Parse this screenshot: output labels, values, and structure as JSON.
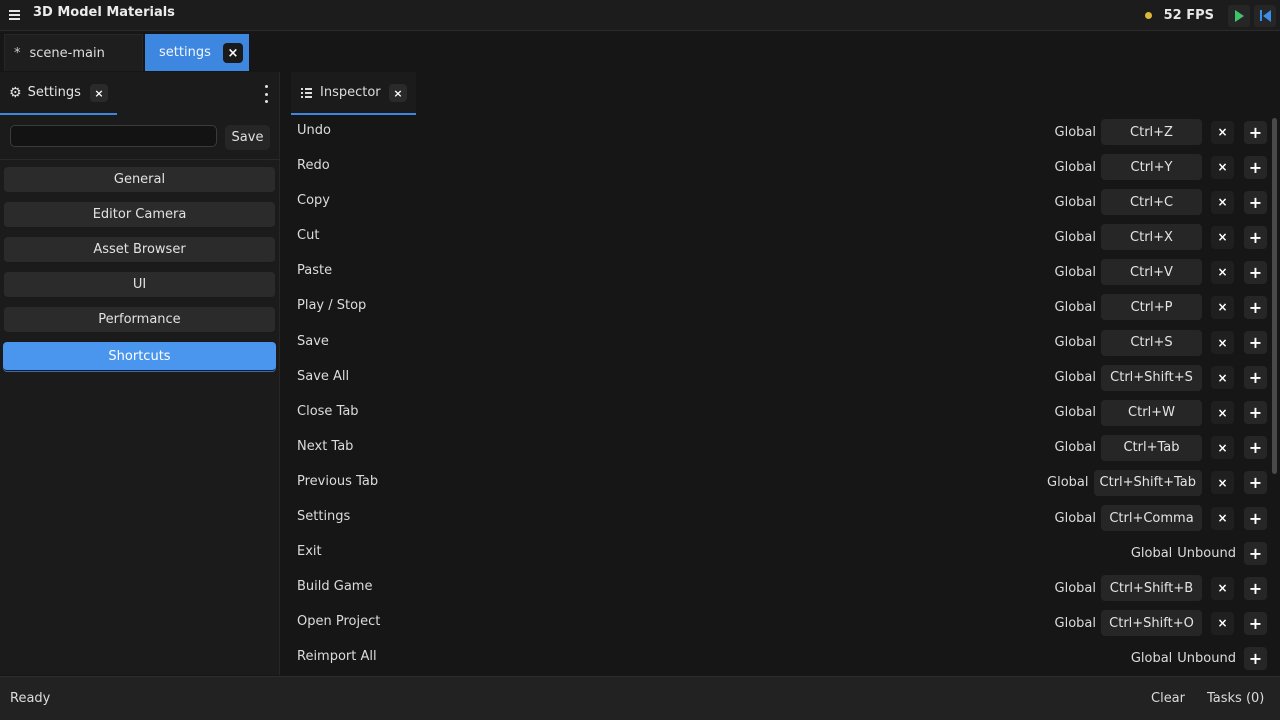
{
  "app": {
    "title": "3D Model Materials",
    "fps": "52 FPS"
  },
  "doc_tabs": [
    {
      "label": "scene-main",
      "modified_marker": "*"
    },
    {
      "label": "settings",
      "close": "×"
    }
  ],
  "left_panel": {
    "tab_label": "Settings",
    "close": "×",
    "search": {
      "value": "",
      "placeholder": ""
    },
    "save_label": "Save",
    "categories": [
      "General",
      "Editor Camera",
      "Asset Browser",
      "UI",
      "Performance",
      "Shortcuts"
    ],
    "active_category": "Shortcuts"
  },
  "inspector": {
    "tab_label": "Inspector",
    "close": "×",
    "rows": [
      {
        "action": "Undo",
        "scope": "Global",
        "key": "Ctrl+Z"
      },
      {
        "action": "Redo",
        "scope": "Global",
        "key": "Ctrl+Y"
      },
      {
        "action": "Copy",
        "scope": "Global",
        "key": "Ctrl+C"
      },
      {
        "action": "Cut",
        "scope": "Global",
        "key": "Ctrl+X"
      },
      {
        "action": "Paste",
        "scope": "Global",
        "key": "Ctrl+V"
      },
      {
        "action": "Play / Stop",
        "scope": "Global",
        "key": "Ctrl+P"
      },
      {
        "action": "Save",
        "scope": "Global",
        "key": "Ctrl+S"
      },
      {
        "action": "Save All",
        "scope": "Global",
        "key": "Ctrl+Shift+S"
      },
      {
        "action": "Close Tab",
        "scope": "Global",
        "key": "Ctrl+W"
      },
      {
        "action": "Next Tab",
        "scope": "Global",
        "key": "Ctrl+Tab"
      },
      {
        "action": "Previous Tab",
        "scope": "Global",
        "key": "Ctrl+Shift+Tab"
      },
      {
        "action": "Settings",
        "scope": "Global",
        "key": "Ctrl+Comma"
      },
      {
        "action": "Exit",
        "scope": "Global",
        "key": null,
        "unbound": "Unbound"
      },
      {
        "action": "Build Game",
        "scope": "Global",
        "key": "Ctrl+Shift+B"
      },
      {
        "action": "Open Project",
        "scope": "Global",
        "key": "Ctrl+Shift+O"
      },
      {
        "action": "Reimport All",
        "scope": "Global",
        "key": null,
        "unbound": "Unbound"
      }
    ],
    "remove_symbol": "×",
    "add_symbol": "+"
  },
  "status": {
    "text": "Ready",
    "clear_label": "Clear",
    "tasks_label": "Tasks (0)"
  },
  "colors": {
    "accent": "#3d87e0",
    "active_category": "#4a96ee",
    "play": "#3ec26b",
    "fps_dot": "#d8b93a"
  },
  "icons": {
    "menu": "hamburger-icon",
    "play": "play-icon",
    "skip": "skip-to-start-icon",
    "settings_tab": "gear-icon",
    "inspector_tab": "list-icon",
    "panel_menu": "kebab-icon"
  }
}
